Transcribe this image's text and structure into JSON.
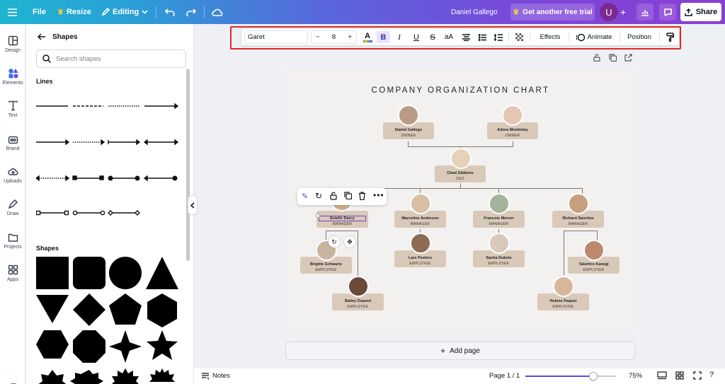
{
  "topbar": {
    "file": "File",
    "resize": "Resize",
    "editing": "Editing",
    "user_name": "Daniel Gallego",
    "trial": "Get another free trial",
    "avatar_initial": "U",
    "share": "Share"
  },
  "rail": {
    "items": [
      "Design",
      "Elements",
      "Text",
      "Brand",
      "Uploads",
      "Draw",
      "Projects",
      "Apps"
    ]
  },
  "panel": {
    "title": "Shapes",
    "search_placeholder": "Search shapes",
    "lines_heading": "Lines",
    "shapes_heading": "Shapes"
  },
  "text_toolbar": {
    "font": "Garet",
    "font_size": "8",
    "minus": "−",
    "plus": "+",
    "bold": "B",
    "italic": "I",
    "underline": "U",
    "strike": "S",
    "case": "aA",
    "effects": "Effects",
    "animate": "Animate",
    "position": "Position"
  },
  "chart": {
    "title": "COMPANY ORGANIZATION CHART",
    "people": [
      {
        "name": "Daniel Gallego",
        "role": "OWNER"
      },
      {
        "name": "Adora Montminy",
        "role": "OWNER"
      },
      {
        "name": "Chad Gibbons",
        "role": "CEO"
      },
      {
        "name": "Estelle Darcy",
        "role": "MANAGER"
      },
      {
        "name": "Marceline Anderson",
        "role": "MANAGER"
      },
      {
        "name": "Francois Mercer",
        "role": "MANAGER"
      },
      {
        "name": "Richard Sanchez",
        "role": "MANAGER"
      },
      {
        "name": "Brigitte Schwartz",
        "role": "EMPLOYEE"
      },
      {
        "name": "Lars Peeters",
        "role": "EMPLOYEE"
      },
      {
        "name": "Sacha Dubois",
        "role": "EMPLOYEE"
      },
      {
        "name": "Takehiro Kanegi",
        "role": "EMPLOYEE"
      },
      {
        "name": "Bailey Dupont",
        "role": "EMPLOYEE"
      },
      {
        "name": "Helene Paquet",
        "role": "EMPLOYEE"
      }
    ]
  },
  "canvas": {
    "add_page": "Add page"
  },
  "bottombar": {
    "notes": "Notes",
    "page_indicator": "Page 1 / 1",
    "zoom": "75%",
    "zoom_level": 0.75
  }
}
